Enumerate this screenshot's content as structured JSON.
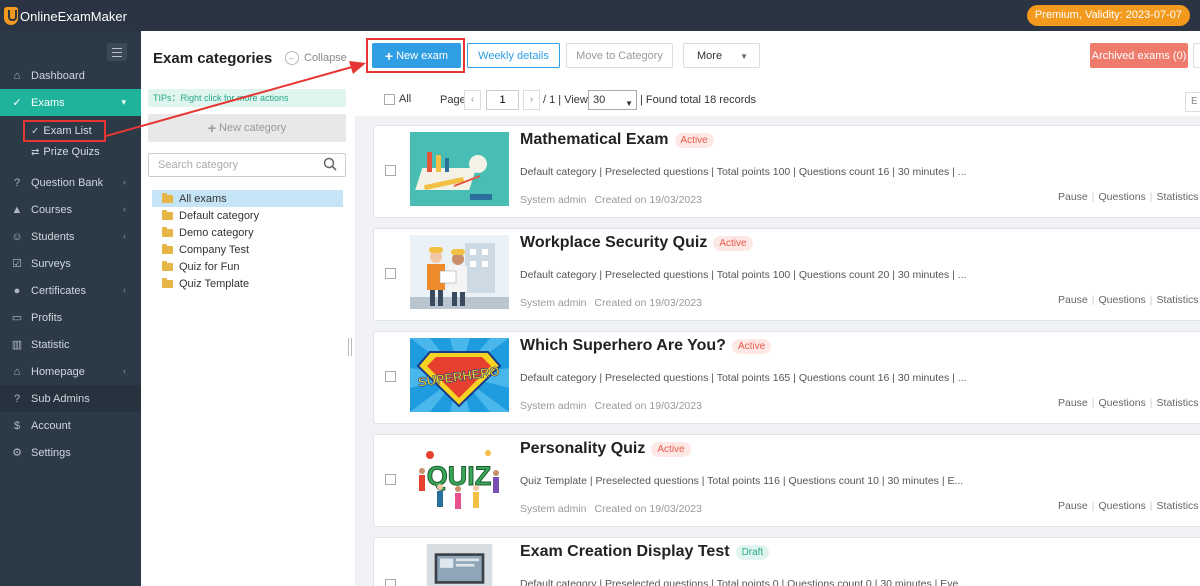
{
  "app": {
    "logo_text": "OnlineExamMaker",
    "premium_label": "Premium, Validity: 2023-07-07"
  },
  "sidebar": {
    "items": [
      {
        "label": "Dashboard",
        "icon": "home-icon"
      },
      {
        "label": "Exams",
        "icon": "check-circle-icon",
        "active": true,
        "has_children": true
      },
      {
        "label": "Question Bank",
        "icon": "question-icon",
        "has_children": true
      },
      {
        "label": "Courses",
        "icon": "graduation-cap-icon",
        "has_children": true
      },
      {
        "label": "Students",
        "icon": "users-icon",
        "has_children": true
      },
      {
        "label": "Surveys",
        "icon": "checkbox-icon"
      },
      {
        "label": "Certificates",
        "icon": "certificate-icon",
        "has_children": true
      },
      {
        "label": "Profits",
        "icon": "card-icon"
      },
      {
        "label": "Statistic",
        "icon": "bar-chart-icon"
      },
      {
        "label": "Homepage",
        "icon": "house-icon",
        "has_children": true
      },
      {
        "label": "Sub Admins",
        "icon": "person-question-icon"
      },
      {
        "label": "Account",
        "icon": "dollar-icon"
      },
      {
        "label": "Settings",
        "icon": "gear-icon"
      }
    ],
    "sub_items": [
      {
        "label": "Exam List",
        "icon": "check-circle-icon"
      },
      {
        "label": "Prize Quizs",
        "icon": "shuffle-icon"
      }
    ]
  },
  "categories": {
    "title": "Exam categories",
    "collapse_label": "Collapse",
    "tips": "TIPs：Right click for more actions",
    "new_category_label": "New category",
    "search_placeholder": "Search category",
    "items": [
      "All exams",
      "Default category",
      "Demo category",
      "Company Test",
      "Quiz for Fun",
      "Quiz Template"
    ],
    "selected": "All exams"
  },
  "toolbar": {
    "new_exam_label": "New exam",
    "weekly_details_label": "Weekly details",
    "move_to_category_label": "Move to Category",
    "more_label": "More",
    "archived_label": "Archived exams (0)"
  },
  "list": {
    "all_label": "All",
    "page_label": "Page",
    "current_page": "1",
    "total_pages_label": "/ 1",
    "view_label": "View",
    "per_page": "30",
    "found_label": "Found total 18 records",
    "edge_label": "E"
  },
  "exams": [
    {
      "title": "Mathematical Exam",
      "status": "Active",
      "info": "Default category | Preselected questions | Total points 100 | Questions count 16 | 30 minutes | ...",
      "author": "System admin",
      "created": "Created on 19/03/2023",
      "actions": [
        "Pause",
        "Questions",
        "Statistics"
      ]
    },
    {
      "title": "Workplace Security Quiz",
      "status": "Active",
      "info": "Default category | Preselected questions | Total points 100 | Questions count 20 | 30 minutes | ...",
      "author": "System admin",
      "created": "Created on 19/03/2023",
      "actions": [
        "Pause",
        "Questions",
        "Statistics"
      ]
    },
    {
      "title": "Which Superhero Are You?",
      "status": "Active",
      "info": "Default category | Preselected questions | Total points 165 | Questions count 16 | 30 minutes | ...",
      "author": "System admin",
      "created": "Created on 19/03/2023",
      "actions": [
        "Pause",
        "Questions",
        "Statistics"
      ],
      "thumb_text": "SUPERHERO"
    },
    {
      "title": "Personality Quiz",
      "status": "Active",
      "info": "Quiz Template | Preselected questions | Total points 116 | Questions count 10 | 30 minutes | E...",
      "author": "System admin",
      "created": "Created on 19/03/2023",
      "actions": [
        "Pause",
        "Questions",
        "Statistics"
      ],
      "thumb_text": "QUIZ"
    },
    {
      "title": "Exam Creation Display Test",
      "status": "Draft",
      "info": "Default category | Preselected questions | Total points 0 | Questions count 0 | 30 minutes | Eve..."
    }
  ],
  "colors": {
    "sidebar_bg": "#2c3a47",
    "accent_green": "#1fb39b",
    "primary_blue": "#2f9ee3",
    "premium_orange": "#f39a1e",
    "archived_red": "#ee7b6b",
    "annotation_red": "#e63633"
  }
}
